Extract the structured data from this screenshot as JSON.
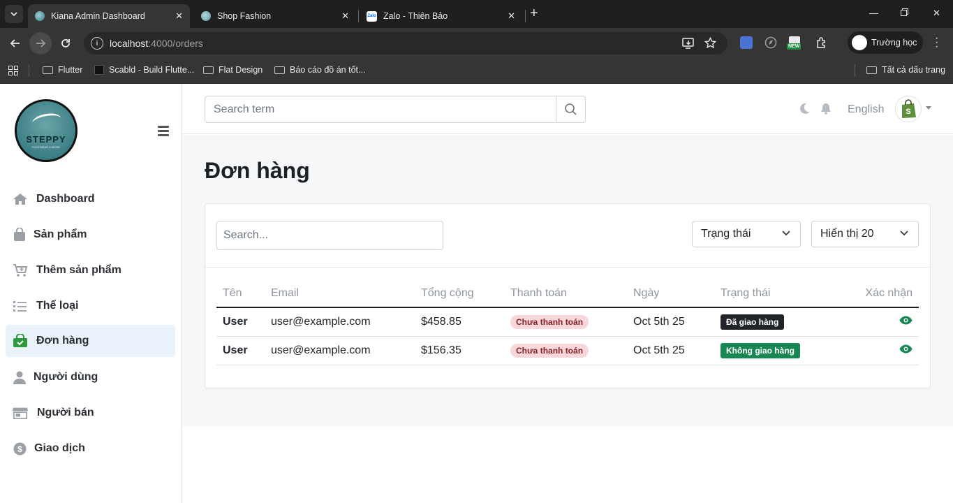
{
  "browser": {
    "tabs": [
      {
        "title": "Kiana Admin Dashboard",
        "active": true
      },
      {
        "title": "Shop Fashion",
        "active": false
      },
      {
        "title": "Zalo - Thiên Bảo",
        "active": false
      }
    ],
    "url_host": "localhost",
    "url_path": ":4000/orders",
    "profile_name": "Trường học",
    "bookmarks": [
      "Flutter",
      "Scabld - Build Flutte...",
      "Flat Design",
      "Báo cáo đồ án tốt..."
    ],
    "all_bookmarks": "Tất cả dấu trang",
    "ext_new_badge": "NEW"
  },
  "sidebar": {
    "logo_brand": "STEPPY",
    "logo_tagline": "FOOTWEAR & MORE",
    "items": [
      {
        "label": "Dashboard",
        "icon": "home-icon"
      },
      {
        "label": "Sản phẩm",
        "icon": "shopping-bag-icon"
      },
      {
        "label": "Thêm sản phẩm",
        "icon": "cart-plus-icon"
      },
      {
        "label": "Thể loại",
        "icon": "list-icon"
      },
      {
        "label": "Đơn hàng",
        "icon": "bag-check-icon",
        "active": true
      },
      {
        "label": "Người dùng",
        "icon": "user-icon"
      },
      {
        "label": "Người bán",
        "icon": "store-icon"
      },
      {
        "label": "Giao dịch",
        "icon": "dollar-icon"
      }
    ]
  },
  "topbar": {
    "search_placeholder": "Search term",
    "language": "English"
  },
  "page": {
    "title": "Đơn hàng",
    "search_placeholder": "Search...",
    "status_select": "Trạng thái",
    "show_select": "Hiển thị 20"
  },
  "orders": {
    "columns": [
      "Tên",
      "Email",
      "Tổng cộng",
      "Thanh toán",
      "Ngày",
      "Trạng thái",
      "Xác nhận"
    ],
    "rows": [
      {
        "name": "User",
        "email": "user@example.com",
        "total": "$458.85",
        "payment": "Chưa thanh toán",
        "date": "Oct 5th 25",
        "status": "Đã giao hàng",
        "status_color": "#212529"
      },
      {
        "name": "User",
        "email": "user@example.com",
        "total": "$156.35",
        "payment": "Chưa thanh toán",
        "date": "Oct 5th 25",
        "status": "Không giao hàng",
        "status_color": "#198754"
      }
    ]
  },
  "colors": {
    "accent_green": "#198754",
    "sidebar_active_bg": "#e9f1fb"
  }
}
